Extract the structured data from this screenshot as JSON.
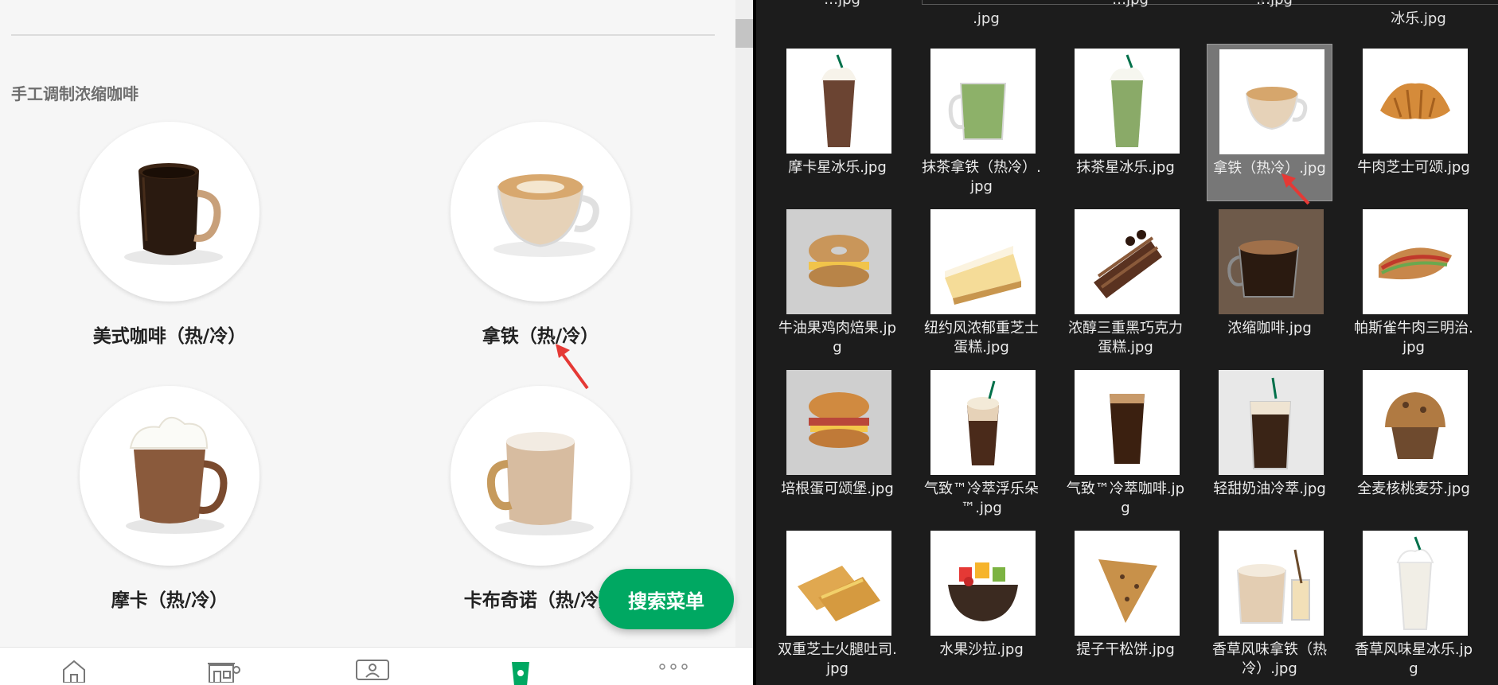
{
  "app": {
    "section_title": "手工调制浓缩咖啡",
    "menu_items": [
      {
        "name": "美式咖啡（热/冷）",
        "icon": "americano-image"
      },
      {
        "name": "拿铁（热/冷）",
        "icon": "latte-image"
      },
      {
        "name": "摩卡（热/冷）",
        "icon": "mocha-image"
      },
      {
        "name": "卡布奇诺（热/冷）",
        "icon": "cappuccino-image"
      }
    ],
    "fab_label": "搜索菜单",
    "bottom_nav": [
      {
        "icon": "home-icon"
      },
      {
        "icon": "store-icon"
      },
      {
        "icon": "profile-card-icon"
      },
      {
        "icon": "cup-icon",
        "active": true
      },
      {
        "icon": "more-icon"
      }
    ],
    "colors": {
      "brand": "#00a862",
      "annotation": "#e53935"
    }
  },
  "explorer": {
    "top_partial_labels": [
      "…jpg",
      ".jpg",
      "…jpg",
      "…jpg",
      "冰乐.jpg"
    ],
    "files": [
      {
        "label": "摩卡星冰乐.jpg",
        "thumb": "mocha-frappuccino"
      },
      {
        "label": "抹茶拿铁（热冷）.jpg",
        "thumb": "matcha-latte"
      },
      {
        "label": "抹茶星冰乐.jpg",
        "thumb": "matcha-frappuccino"
      },
      {
        "label": "拿铁（热冷）.jpg",
        "thumb": "latte",
        "selected": true
      },
      {
        "label": "牛肉芝士可颂.jpg",
        "thumb": "croissant"
      },
      {
        "label": "牛油果鸡肉焙果.jpg",
        "thumb": "bagel"
      },
      {
        "label": "纽约风浓郁重芝士蛋糕.jpg",
        "thumb": "cheesecake"
      },
      {
        "label": "浓醇三重黑巧克力蛋糕.jpg",
        "thumb": "chocolate-cake"
      },
      {
        "label": "浓缩咖啡.jpg",
        "thumb": "espresso"
      },
      {
        "label": "帕斯雀牛肉三明治.jpg",
        "thumb": "sandwich"
      },
      {
        "label": "培根蛋可颂堡.jpg",
        "thumb": "bacon-croissant"
      },
      {
        "label": "气致™冷萃浮乐朵™.jpg",
        "thumb": "nitro-float"
      },
      {
        "label": "气致™冷萃咖啡.jpg",
        "thumb": "nitro-cold-brew"
      },
      {
        "label": "轻甜奶油冷萃.jpg",
        "thumb": "cold-brew-cream"
      },
      {
        "label": "全麦核桃麦芬.jpg",
        "thumb": "muffin"
      },
      {
        "label": "双重芝士火腿吐司.jpg",
        "thumb": "ham-toast"
      },
      {
        "label": "水果沙拉.jpg",
        "thumb": "fruit-salad"
      },
      {
        "label": "提子干松饼.jpg",
        "thumb": "scone"
      },
      {
        "label": "香草风味拿铁（热冷）.jpg",
        "thumb": "vanilla-latte"
      },
      {
        "label": "香草风味星冰乐.jpg",
        "thumb": "vanilla-frappuccino"
      }
    ]
  }
}
